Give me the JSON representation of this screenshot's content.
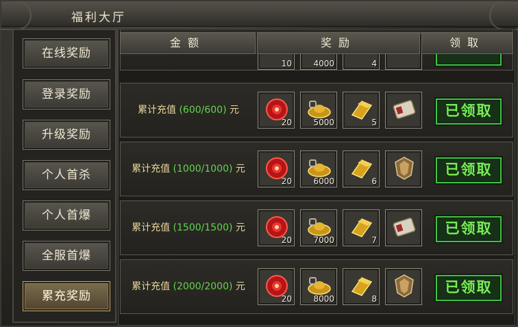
{
  "window": {
    "title": "福利大厅"
  },
  "sidebar": {
    "items": [
      {
        "label": "在线奖励",
        "active": false
      },
      {
        "label": "登录奖励",
        "active": false
      },
      {
        "label": "升级奖励",
        "active": false
      },
      {
        "label": "个人首杀",
        "active": false
      },
      {
        "label": "个人首爆",
        "active": false
      },
      {
        "label": "全服首爆",
        "active": false
      },
      {
        "label": "累充奖励",
        "active": true
      }
    ]
  },
  "table": {
    "headers": {
      "amount": "金额",
      "reward": "奖励",
      "claim": "领取"
    },
    "partial_row": {
      "counts": [
        "10",
        "4000",
        "4",
        ""
      ]
    },
    "rows": [
      {
        "prefix": "累计充值",
        "progress": "(600/600)",
        "unit": "元",
        "rewards": [
          {
            "icon": "red-gem-icon",
            "count": "20"
          },
          {
            "icon": "gold-ingot-icon",
            "count": "5000"
          },
          {
            "icon": "gold-bar-icon",
            "count": "5"
          },
          {
            "icon": "scroll-icon",
            "count": ""
          }
        ],
        "claim_label": "已领取"
      },
      {
        "prefix": "累计充值",
        "progress": "(1000/1000)",
        "unit": "元",
        "rewards": [
          {
            "icon": "red-gem-icon",
            "count": "20"
          },
          {
            "icon": "gold-ingot-icon",
            "count": "6000"
          },
          {
            "icon": "gold-bar-icon",
            "count": "6"
          },
          {
            "icon": "shield-icon",
            "count": ""
          }
        ],
        "claim_label": "已领取"
      },
      {
        "prefix": "累计充值",
        "progress": "(1500/1500)",
        "unit": "元",
        "rewards": [
          {
            "icon": "red-gem-icon",
            "count": "20"
          },
          {
            "icon": "gold-ingot-icon",
            "count": "7000"
          },
          {
            "icon": "gold-bar-icon",
            "count": "7"
          },
          {
            "icon": "scroll-icon",
            "count": ""
          }
        ],
        "claim_label": "已领取"
      },
      {
        "prefix": "累计充值",
        "progress": "(2000/2000)",
        "unit": "元",
        "rewards": [
          {
            "icon": "red-gem-icon",
            "count": "20"
          },
          {
            "icon": "gold-ingot-icon",
            "count": "8000"
          },
          {
            "icon": "gold-bar-icon",
            "count": "8"
          },
          {
            "icon": "shield-icon",
            "count": ""
          }
        ],
        "claim_label": "已领取"
      }
    ]
  },
  "colors": {
    "progress_green": "#61d64f",
    "claim_green": "#77ee55",
    "amount_gold": "#e8d79d"
  }
}
